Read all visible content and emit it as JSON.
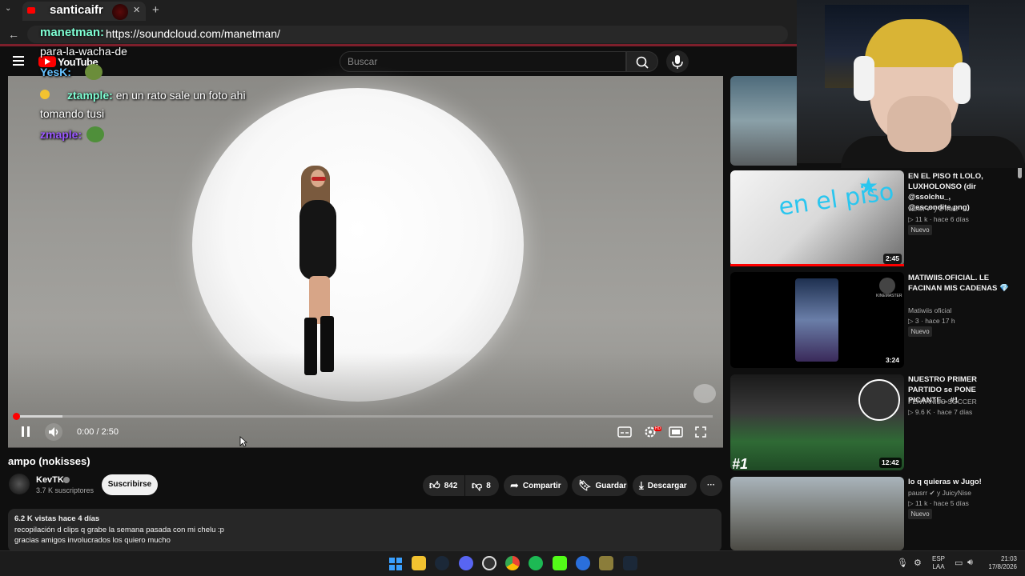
{
  "browser": {
    "tab_title": "santicaifr",
    "tab_close": "✕",
    "tab_add": "+",
    "tab_list": "⌄",
    "back": "←",
    "overlay_channel": "manetman:",
    "url": "https://soundcloud.com/manetman/"
  },
  "youtube": {
    "logo_text": "YouTube",
    "search_placeholder": "Buscar"
  },
  "chat": [
    {
      "user": "",
      "text": "para-la-wacha-de"
    },
    {
      "user": "YesK:",
      "text": ""
    },
    {
      "user": "ztample:",
      "text": "en un rato sale un foto ahi"
    },
    {
      "user": "",
      "text": "tomando tusi"
    },
    {
      "user": "zmaple:",
      "text": ""
    }
  ],
  "player": {
    "time": "0:00 / 2:50",
    "progress": 0.0,
    "hd": "HD"
  },
  "video": {
    "title": "ampo (nokisses)",
    "channel": "KevTK",
    "subscribers": "3.7 K suscriptores",
    "subscribe": "Suscribirse",
    "likes": "842",
    "dislikes": "8",
    "share": "Compartir",
    "save": "Guardar",
    "download": "Descargar",
    "more": "···",
    "stats": "6.2 K vistas  hace 4 días",
    "desc1": "recopilación d clips q grabe la semana pasada con mi chelu :p",
    "desc2": "gracias amigos involucrados los quiero mucho"
  },
  "sidebar": [
    {
      "title": "EN EL PISO ft LOLO, LUXHOLONSO (dir @ssolchu_, @escondite.png)",
      "channel": "vahel",
      "extra": "y 2 más",
      "views": "11 k",
      "age": "hace 6 días",
      "badge": "Nuevo",
      "duration": "2:45"
    },
    {
      "title": "MATIWIIS.OFICIAL. LE FACINAN MIS CADENAS 💎",
      "channel": "Matiwiis oficial",
      "extra": "",
      "views": "3",
      "age": "hace 17 h",
      "badge": "Nuevo",
      "duration": "3:24"
    },
    {
      "title": "NUESTRO PRIMER PARTIDO se PONE PICANTE... #1",
      "channel": "FENTANILO SOCCER",
      "extra": "",
      "views": "9.6 K",
      "age": "hace 7 días",
      "badge": "",
      "duration": "12:42",
      "thumb_tag": "#1"
    },
    {
      "title": "lo q quieras w Jugo!",
      "channel": "pausrr",
      "extra": "y JuicyNise",
      "views": "11 k",
      "age": "hace 5 días",
      "badge": "Nuevo",
      "duration": ""
    }
  ],
  "thumb_texts": {
    "piso": "en el piso",
    "kinemaster": "KINEMASTER"
  },
  "taskbar": {
    "lang1": "ESP",
    "lang2": "LAA",
    "time": "21:03",
    "date": "17/8/2026"
  }
}
